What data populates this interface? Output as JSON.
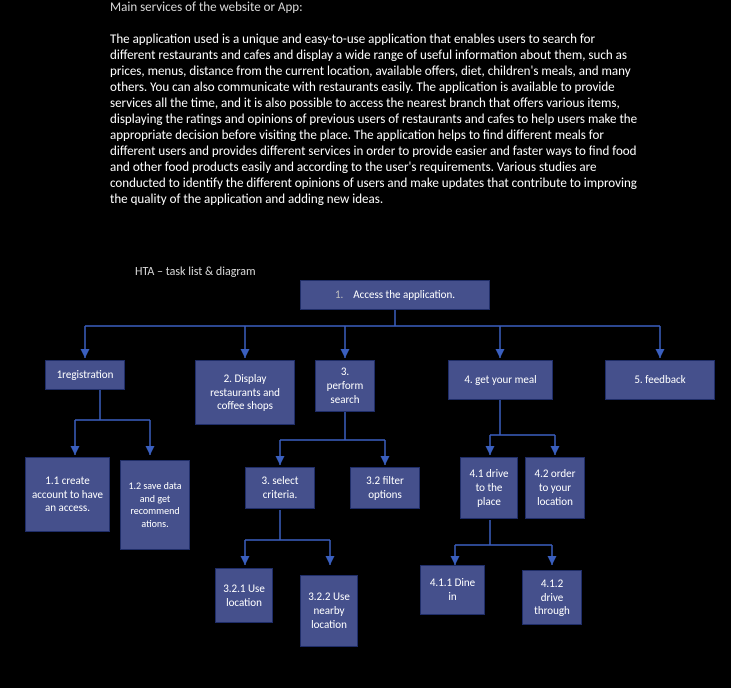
{
  "description": {
    "title": "Main services of the website or App:",
    "body": "The application used is a unique and easy-to-use application that enables users to search for different restaurants and cafes and display a wide range of useful information about them, such as prices, menus, distance from the current location, available offers, diet, children's meals, and many others. You can also communicate with restaurants easily. The application is available to provide services all the time, and it is also possible to access the nearest branch that offers various items, displaying the ratings and opinions of previous users of restaurants and cafes to help users make the appropriate decision before visiting the place. The application helps to find different meals for different users and provides different services in order to provide easier and faster ways to find food and other food products easily and according to the user's requirements. Various studies are conducted to identify the different opinions of users and make updates that contribute to improving the quality of the application and adding new ideas."
  },
  "section_label": "HTA   – task list & diagram",
  "diagram": {
    "root": {
      "num": "1.",
      "label": "Access the application."
    },
    "n1": "1registration",
    "n2": "2. Display restaurants and coffee shops",
    "n3": "3. perform search",
    "n4": "4. get your meal",
    "n5": "5. feedback",
    "n11": "1.1 create account to have an access.",
    "n12": "1.2 save data and get recommend ations.",
    "n31": "3. select criteria.",
    "n32": "3.2 filter options",
    "n41": "4.1 drive to the place",
    "n42": "4.2 order to your location",
    "n321": "3.2.1 Use location",
    "n322": "3.2.2 Use nearby location",
    "n411": "4.1.1 Dine in",
    "n412": "4.1.2 drive through"
  }
}
